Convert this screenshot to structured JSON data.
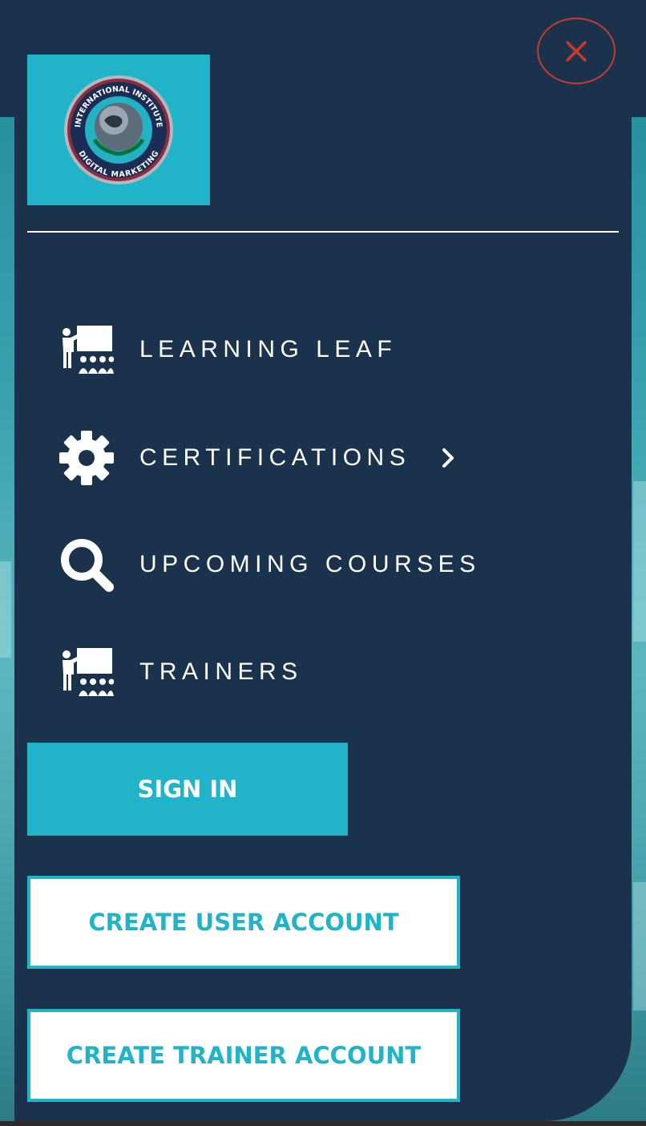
{
  "brand": {
    "logo_ring_text_top": "INTERNATIONAL INSTITUTE",
    "logo_ring_text_bottom": "DIGITAL MARKETING",
    "logo_icon": "globe-laurel-seal-icon"
  },
  "close": {
    "icon": "close-icon",
    "color": "#c8392e"
  },
  "nav": {
    "items": [
      {
        "label": "LEARNING LEAF",
        "icon": "presentation-icon"
      },
      {
        "label": "CERTIFICATIONS",
        "icon": "gear-icon",
        "has_submenu": true
      },
      {
        "label": "UPCOMING COURSES",
        "icon": "search-icon"
      },
      {
        "label": "TRAINERS",
        "icon": "presentation-icon"
      }
    ]
  },
  "buttons": {
    "sign_in": "SIGN IN",
    "create_user": "CREATE USER ACCOUNT",
    "create_trainer": "CREATE TRAINER ACCOUNT"
  },
  "colors": {
    "panel": "#1a324c",
    "accent": "#21b4c8",
    "text": "#ffffff"
  }
}
